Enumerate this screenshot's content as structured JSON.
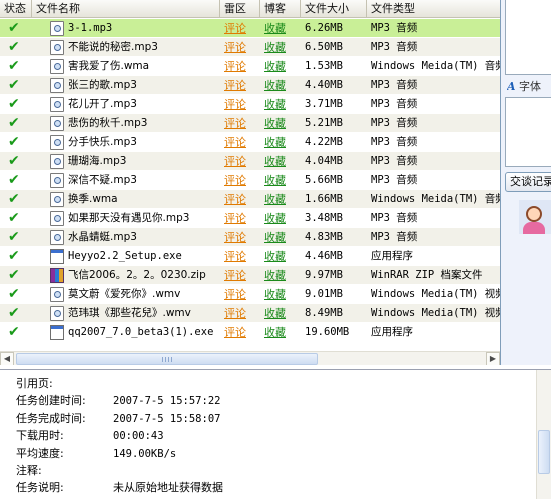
{
  "columns": {
    "status": "状态",
    "name": "文件名称",
    "thunder_zone": "雷区",
    "blog": "博客",
    "size": "文件大小",
    "type": "文件类型"
  },
  "files": [
    {
      "name": "3-1.mp3",
      "icon": "mp3",
      "comment": "评论",
      "collect": "收藏",
      "size": "6.26MB",
      "type": "MP3 音频",
      "selected": true
    },
    {
      "name": "不能说的秘密.mp3",
      "icon": "mp3",
      "comment": "评论",
      "collect": "收藏",
      "size": "6.50MB",
      "type": "MP3 音频"
    },
    {
      "name": "害我爱了伤.wma",
      "icon": "wma",
      "comment": "评论",
      "collect": "收藏",
      "size": "1.53MB",
      "type": "Windows Meida(TM) 音频"
    },
    {
      "name": "张三的歌.mp3",
      "icon": "mp3",
      "comment": "评论",
      "collect": "收藏",
      "size": "4.40MB",
      "type": "MP3 音频"
    },
    {
      "name": "花儿开了.mp3",
      "icon": "mp3",
      "comment": "评论",
      "collect": "收藏",
      "size": "3.71MB",
      "type": "MP3 音频"
    },
    {
      "name": "悲伤的秋千.mp3",
      "icon": "mp3",
      "comment": "评论",
      "collect": "收藏",
      "size": "5.21MB",
      "type": "MP3 音频"
    },
    {
      "name": "分手快乐.mp3",
      "icon": "mp3",
      "comment": "评论",
      "collect": "收藏",
      "size": "4.22MB",
      "type": "MP3 音频"
    },
    {
      "name": "珊瑚海.mp3",
      "icon": "mp3",
      "comment": "评论",
      "collect": "收藏",
      "size": "4.04MB",
      "type": "MP3 音频"
    },
    {
      "name": "深信不疑.mp3",
      "icon": "mp3",
      "comment": "评论",
      "collect": "收藏",
      "size": "5.66MB",
      "type": "MP3 音频"
    },
    {
      "name": "换季.wma",
      "icon": "wma",
      "comment": "评论",
      "collect": "收藏",
      "size": "1.66MB",
      "type": "Windows Meida(TM) 音频"
    },
    {
      "name": "如果那天没有遇见你.mp3",
      "icon": "mp3",
      "comment": "评论",
      "collect": "收藏",
      "size": "3.48MB",
      "type": "MP3 音频"
    },
    {
      "name": "水晶蜻蜓.mp3",
      "icon": "mp3",
      "comment": "评论",
      "collect": "收藏",
      "size": "4.83MB",
      "type": "MP3 音频"
    },
    {
      "name": "Heyyo2.2_Setup.exe",
      "icon": "exe",
      "comment": "评论",
      "collect": "收藏",
      "size": "4.46MB",
      "type": "应用程序"
    },
    {
      "name": "飞信2006。2。2。0230.zip",
      "icon": "zip",
      "comment": "评论",
      "collect": "收藏",
      "size": "9.97MB",
      "type": "WinRAR ZIP 档案文件"
    },
    {
      "name": "莫文蔚《爱死你》.wmv",
      "icon": "wmv",
      "comment": "评论",
      "collect": "收藏",
      "size": "9.01MB",
      "type": "Windows Media(TM) 视频文件"
    },
    {
      "name": "范玮琪《那些花兒》.wmv",
      "icon": "wmv",
      "comment": "评论",
      "collect": "收藏",
      "size": "8.49MB",
      "type": "Windows Media(TM) 视频文件"
    },
    {
      "name": "qq2007_7.0_beta3(1).exe",
      "icon": "exe",
      "comment": "评论",
      "collect": "收藏",
      "size": "19.60MB",
      "type": "应用程序"
    }
  ],
  "chat": {
    "font_label": "字体",
    "history_button": "交谈记录"
  },
  "details": [
    {
      "label": "引用页:",
      "value": ""
    },
    {
      "label": "任务创建时间:",
      "value": "2007-7-5 15:57:22"
    },
    {
      "label": "任务完成时间:",
      "value": "2007-7-5 15:58:07"
    },
    {
      "label": "下载用时:",
      "value": "00:00:43"
    },
    {
      "label": "平均速度:",
      "value": "149.00KB/s"
    },
    {
      "label": "注释:",
      "value": ""
    },
    {
      "label": "任务说明:",
      "value": "未从原始地址获得数据"
    }
  ],
  "colors": {
    "selected_row": "#c9ef97",
    "comment_link": "#e07a00",
    "collect_link": "#1a8a1a",
    "check": "#1a9a1a"
  }
}
